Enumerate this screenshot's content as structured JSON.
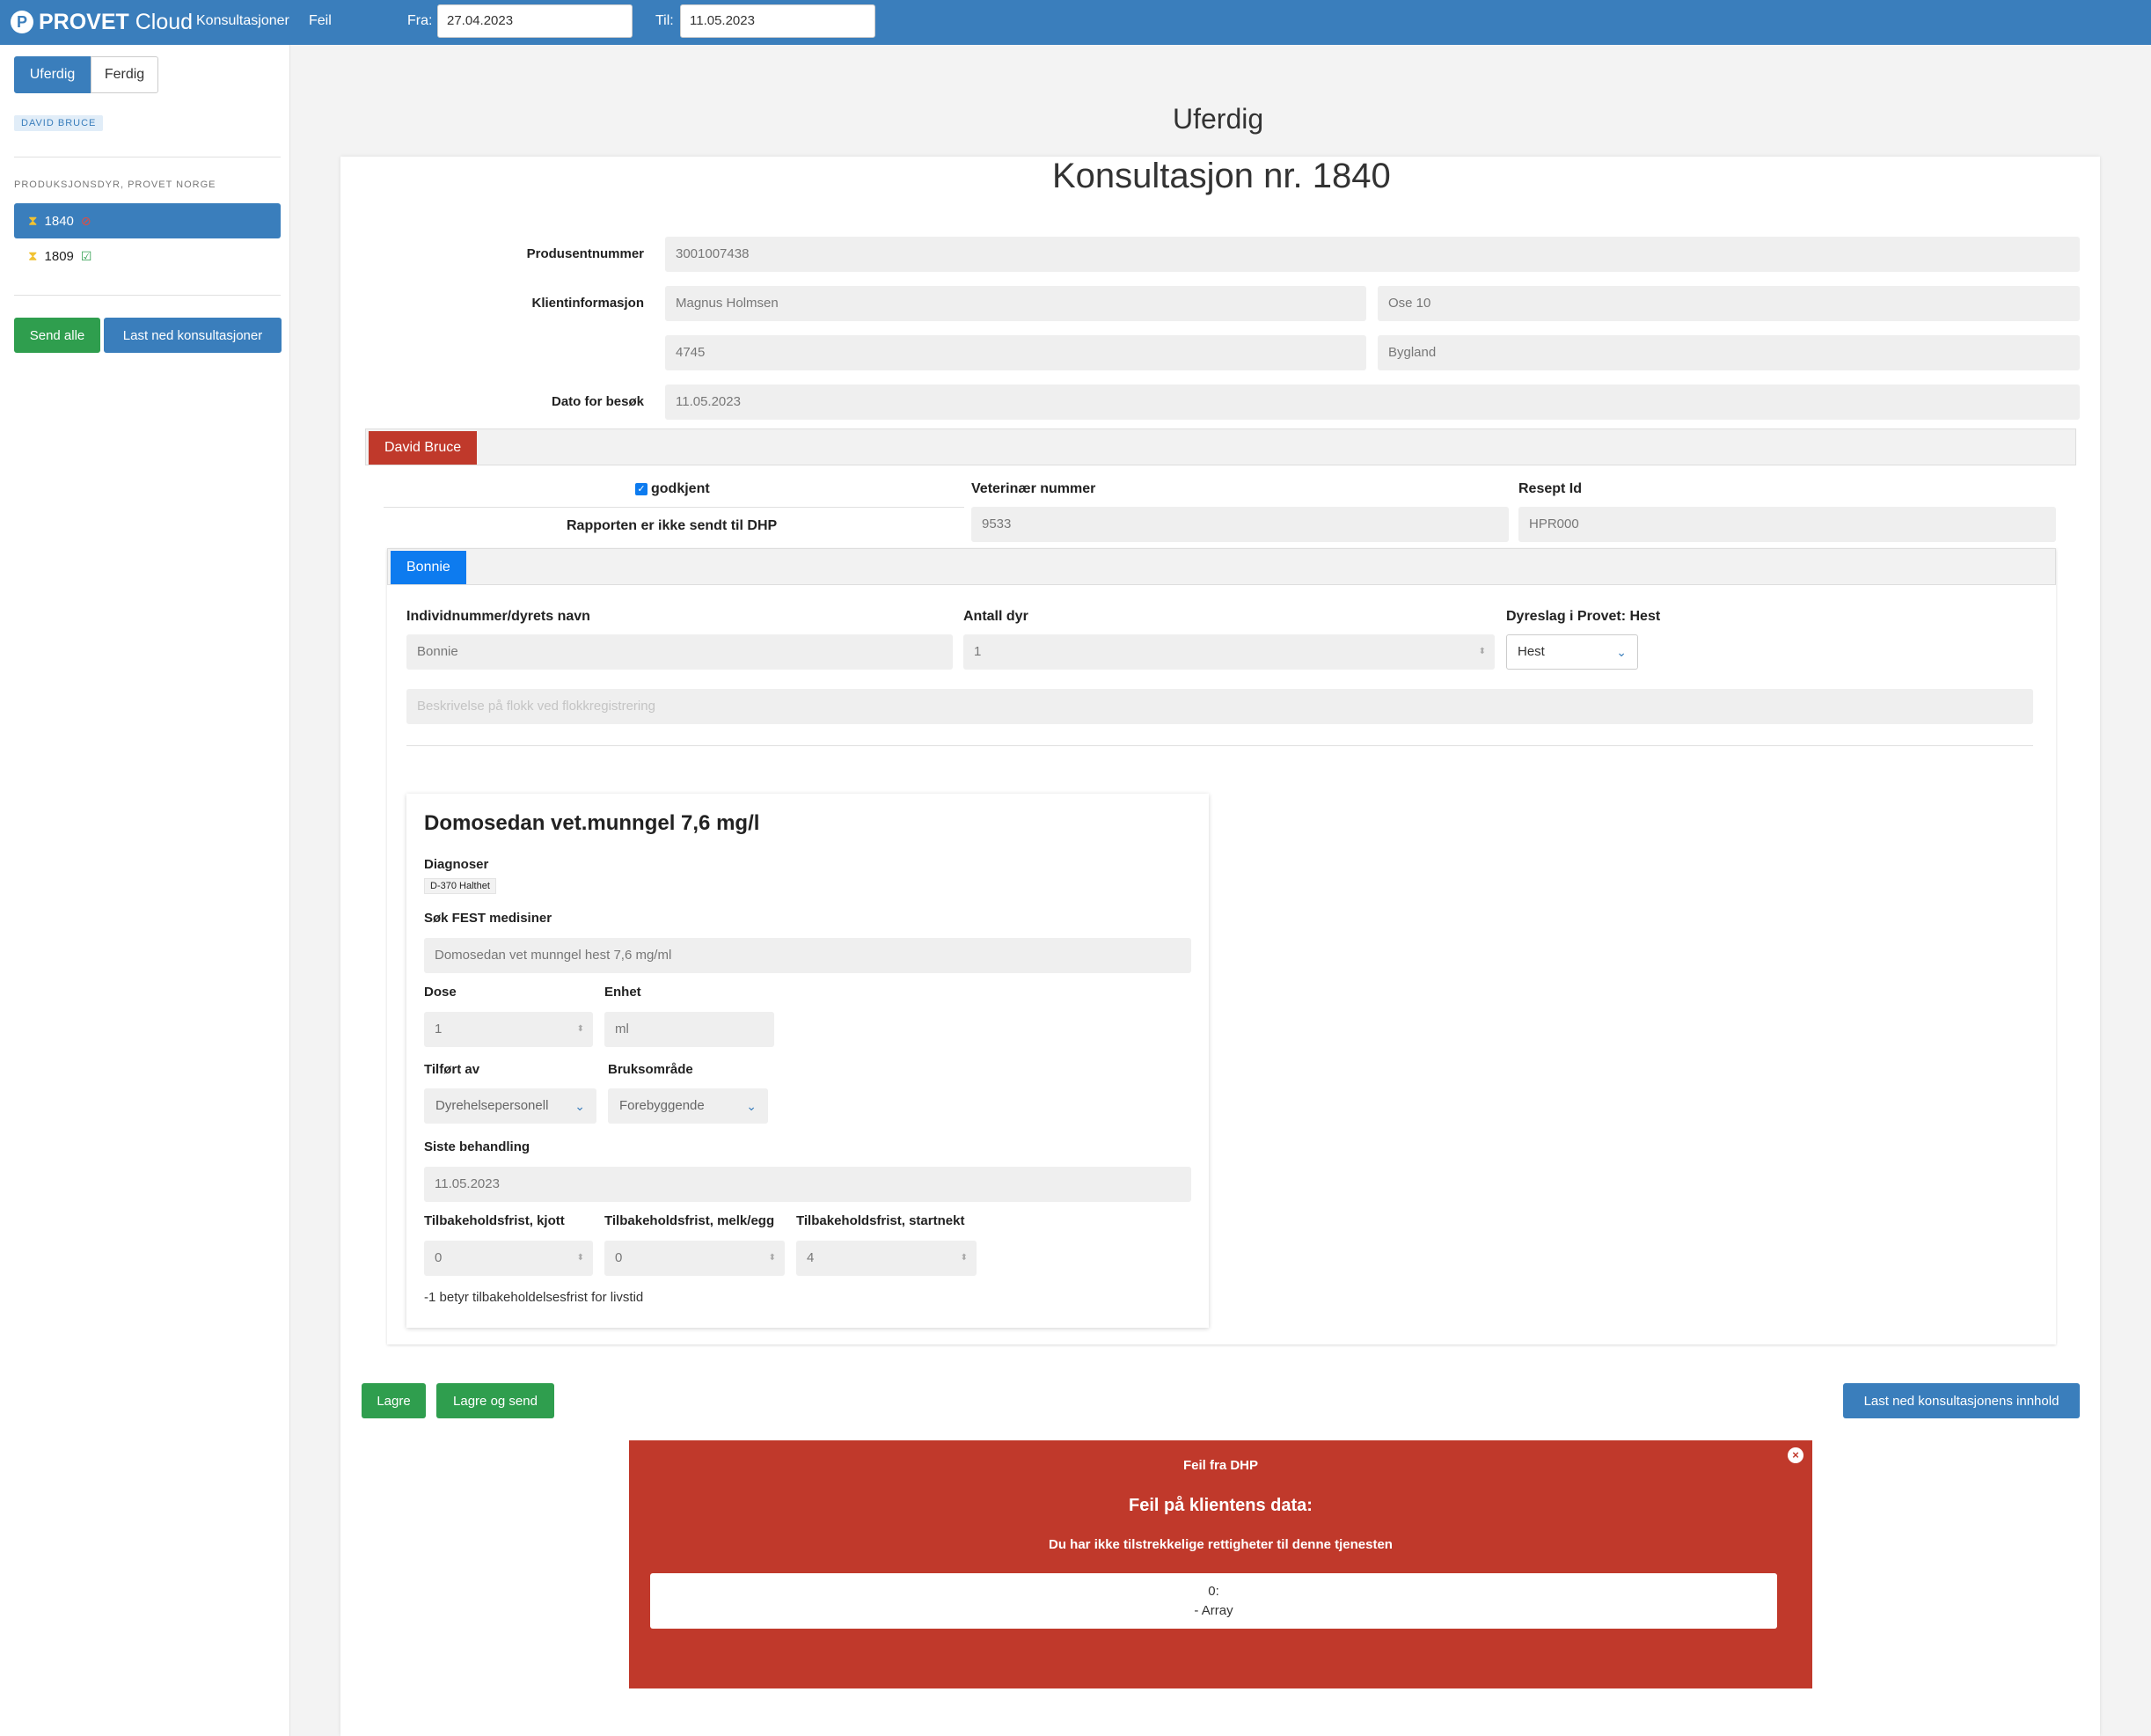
{
  "header": {
    "brand_bold": "PROVET",
    "brand_light": "Cloud",
    "nav": [
      "Konsultasjoner",
      "Feil"
    ],
    "from_label": "Fra:",
    "from_value": "27.04.2023",
    "to_label": "Til:",
    "to_value": "11.05.2023"
  },
  "sidebar": {
    "tabs": [
      "Uferdig",
      "Ferdig"
    ],
    "user_chip": "DAVID BRUCE",
    "section_label": "PRODUKSJONSDYR, PROVET NORGE",
    "items": [
      {
        "id": "1840",
        "status": "blocked"
      },
      {
        "id": "1809",
        "status": "ok"
      }
    ],
    "send_all": "Send alle",
    "download_all": "Last ned konsultasjoner"
  },
  "main": {
    "heading": "Uferdig",
    "consultation_title": "Konsultasjon nr. 1840",
    "labels": {
      "producer": "Produsentnummer",
      "client": "Klientinformasjon",
      "visit_date": "Dato for besøk"
    },
    "values": {
      "producer": "3001007438",
      "client_name": "Magnus Holmsen",
      "client_address": "Ose 10",
      "client_zip": "4745",
      "client_city": "Bygland",
      "visit_date": "11.05.2023"
    }
  },
  "vet_tab": {
    "label": "David Bruce",
    "approved": "godkjent",
    "report_status": "Rapporten er ikke sendt til DHP",
    "vet_number_label": "Veterinær nummer",
    "vet_number": "9533",
    "prescription_label": "Resept Id",
    "prescription": "HPR000"
  },
  "animal_tab": {
    "label": "Bonnie",
    "id_label": "Individnummer/dyrets navn",
    "id_value": "Bonnie",
    "count_label": "Antall dyr",
    "count_value": "1",
    "species_label": "Dyreslag i Provet: Hest",
    "species_value": "Hest",
    "flock_placeholder": "Beskrivelse på flokk ved flokkregistrering"
  },
  "medication": {
    "title": "Domosedan vet.munngel 7,6 mg/l",
    "diagnoses_label": "Diagnoser",
    "diagnosis": "D-370 Halthet",
    "search_label": "Søk FEST medisiner",
    "search_value": "Domosedan vet munngel hest 7,6 mg/ml",
    "dose_label": "Dose",
    "dose_value": "1",
    "unit_label": "Enhet",
    "unit_value": "ml",
    "given_by_label": "Tilført av",
    "given_by_value": "Dyrehelsepersonell",
    "usage_label": "Bruksområde",
    "usage_value": "Forebyggende",
    "last_treatment_label": "Siste behandling",
    "last_treatment_value": "11.05.2023",
    "withdrawal_meat_label": "Tilbakeholdsfrist, kjott",
    "withdrawal_meat_value": "0",
    "withdrawal_milk_label": "Tilbakeholdsfrist, melk/egg",
    "withdrawal_milk_value": "0",
    "withdrawal_start_label": "Tilbakeholdsfrist, startnekt",
    "withdrawal_start_value": "4",
    "hint": "-1 betyr tilbakeholdelsesfrist for livstid"
  },
  "actions": {
    "save": "Lagre",
    "save_send": "Lagre og send",
    "download": "Last ned konsultasjonens innhold"
  },
  "error": {
    "header": "Feil fra DHP",
    "title": "Feil på klientens data:",
    "message": "Du har ikke tilstrekkelige rettigheter til denne tjenesten",
    "detail_line1": "0:",
    "detail_line2": "- Array"
  },
  "colors": {
    "primary": "#3a7ebc",
    "success": "#2f9e4e",
    "danger": "#c0392b",
    "tab_blue": "#0d7bef"
  }
}
